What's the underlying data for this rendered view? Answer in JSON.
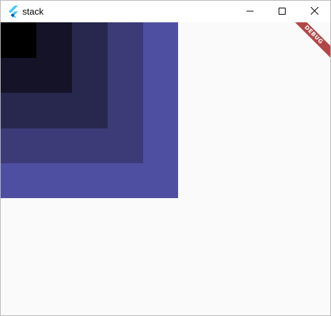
{
  "window": {
    "title": "stack",
    "app_icon": "flutter-logo-icon"
  },
  "controls": {
    "minimize_icon": "minimize-icon",
    "maximize_icon": "maximize-icon",
    "close_icon": "close-icon"
  },
  "content": {
    "squares": [
      {
        "color": "#4f4fa2"
      },
      {
        "color": "#3c3b78"
      },
      {
        "color": "#28274e"
      },
      {
        "color": "#141327"
      },
      {
        "color": "#000000"
      }
    ],
    "background": "#fafafa"
  },
  "debug_banner": {
    "label": "DEBUG",
    "color": "#a52a2a"
  }
}
